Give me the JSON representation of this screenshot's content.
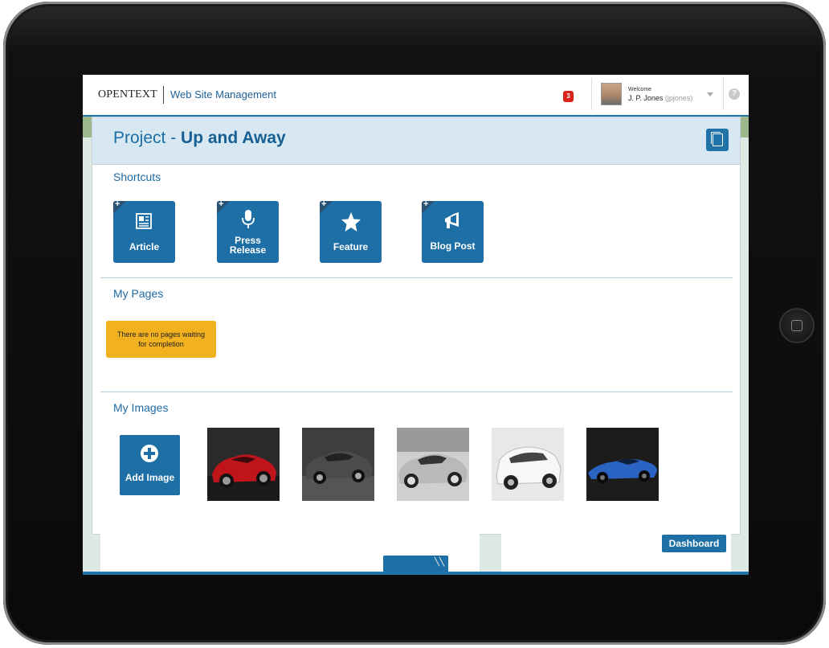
{
  "header": {
    "logo_text": "OPENTEXT",
    "product_name": "Web Site Management",
    "notification_count": "3",
    "welcome_label": "Welcome",
    "user_name": "J. P. Jones",
    "user_id": "(jpjones)",
    "help_glyph": "?"
  },
  "project": {
    "prefix": "Project - ",
    "name": "Up and Away"
  },
  "shortcuts": {
    "title": "Shortcuts",
    "items": [
      {
        "label": "Article",
        "icon": "article-icon"
      },
      {
        "label_line1": "Press",
        "label_line2": "Release",
        "icon": "microphone-icon"
      },
      {
        "label": "Feature",
        "icon": "star-icon"
      },
      {
        "label": "Blog Post",
        "icon": "megaphone-icon"
      }
    ],
    "plus_glyph": "+"
  },
  "my_pages": {
    "title": "My Pages",
    "empty_message": "There are no pages waiting for completion"
  },
  "my_images": {
    "title": "My Images",
    "add_label": "Add Image",
    "images": [
      {
        "subject": "red sports car"
      },
      {
        "subject": "dark sedan"
      },
      {
        "subject": "silver tuned sports car"
      },
      {
        "subject": "white SUV"
      },
      {
        "subject": "blue concept car"
      }
    ]
  },
  "footer": {
    "dashboard_label": "Dashboard"
  },
  "colors": {
    "brand_blue": "#1d6fa6",
    "header_bg": "#d7e8f2",
    "warning": "#f2b11e",
    "notification_red": "#d9251c"
  }
}
